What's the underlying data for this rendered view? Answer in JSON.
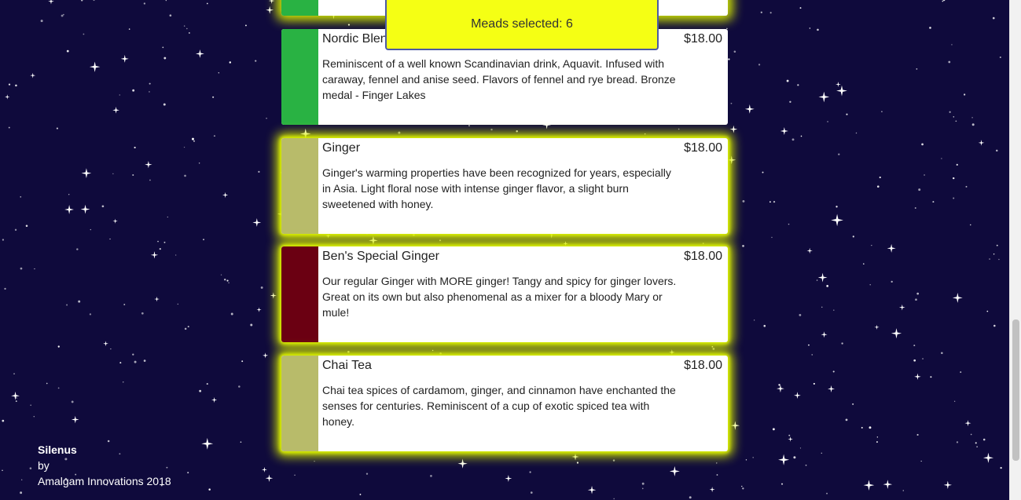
{
  "selection_badge": {
    "label": "Meads selected: 6"
  },
  "colors": {
    "background": "#0f0a3c",
    "glow": "#d8ee00",
    "badge": "#f5ff14",
    "green": "#29b243",
    "olive": "#b8bb6a",
    "maroon": "#6b0012"
  },
  "top_card": {
    "swatch_color": "#29b243"
  },
  "meads": [
    {
      "name": "Nordic Blend",
      "price": "$18.00",
      "description": "Reminiscent of a well known Scandinavian drink, Aquavit. Infused with caraway, fennel and anise seed. Flavors of fennel and rye bread. Bronze medal - Finger Lakes",
      "swatch_color": "#29b243",
      "selected": false
    },
    {
      "name": "Ginger",
      "price": "$18.00",
      "description": "Ginger's warming properties have been recognized for years, especially in Asia. Light floral nose with intense ginger flavor, a slight burn sweetened with honey.",
      "swatch_color": "#b8bb6a",
      "selected": true
    },
    {
      "name": "Ben's Special Ginger",
      "price": "$18.00",
      "description": "Our regular Ginger with MORE ginger! Tangy and spicy for ginger lovers. Great on its own but also phenomenal as a mixer for a bloody Mary or mule!",
      "swatch_color": "#6b0012",
      "selected": true
    },
    {
      "name": "Chai Tea",
      "price": "$18.00",
      "description": "Chai tea spices of cardamom, ginger, and cinnamon have enchanted the senses for centuries. Reminiscent of a cup of exotic spiced tea with honey.",
      "swatch_color": "#b8bb6a",
      "selected": true
    }
  ],
  "footer": {
    "brand": "Silenus",
    "by": "by",
    "company": "Amalgam Innovations 2018"
  }
}
